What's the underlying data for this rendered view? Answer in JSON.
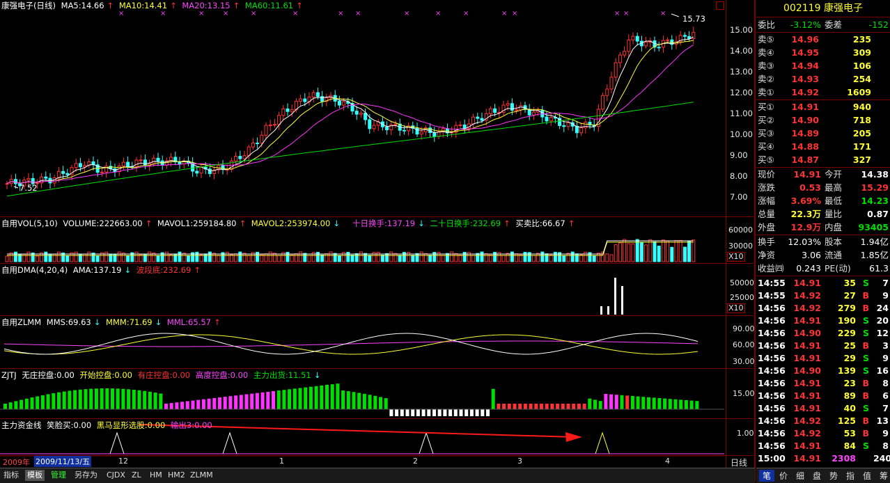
{
  "header": {
    "title": "康强电子(日线)",
    "ma5": "MA5:14.66",
    "ma10": "MA10:14.41",
    "ma20": "MA20:13.15",
    "ma60": "MA60:11.61",
    "high_label": "15.73",
    "low_label": "7.52"
  },
  "price_axis": [
    "15.00",
    "14.00",
    "13.00",
    "12.00",
    "11.00",
    "10.00",
    "9.00",
    "8.00",
    "7.00"
  ],
  "vol_panel": {
    "name": "自用VOL(5,10)",
    "volume": "VOLUME:222663.00",
    "mavol1": "MAVOL1:259184.80",
    "mavol2": "MAVOL2:253974.00",
    "turnover10": "十日换手:137.19",
    "turnover20": "二十日换手:232.69",
    "buysell": "买卖比:66.67",
    "axis": [
      "60000",
      "30000"
    ],
    "unit": "X10"
  },
  "dma_panel": {
    "name": "自用DMA(4,20,4)",
    "ama": "AMA:137.19",
    "wave": "波段底:232.69",
    "axis": [
      "50000",
      "25000"
    ],
    "unit": "X10"
  },
  "zlmm_panel": {
    "name": "自用ZLMM",
    "mms": "MMS:69.63",
    "mmm": "MMM:71.69",
    "mml": "MML:65.57",
    "axis": [
      "90.00",
      "60.00",
      "30.00"
    ]
  },
  "zjtj_panel": {
    "name": "ZJTJ",
    "a": "无庄控盘:0.00",
    "b": "开始控盘:0.00",
    "c": "有庄控盘:0.00",
    "d": "高度控盘:0.00",
    "e": "主力出货:11.51",
    "axis": [
      "15.00"
    ]
  },
  "zlzj_panel": {
    "name": "主力资金线",
    "a": "笑脸买:0.00",
    "b": "黑马显形选股:0.00",
    "c": "输出3:0.00",
    "axis": [
      "1.00"
    ]
  },
  "x_axis": {
    "year": "2009年",
    "date": "2009/11/13/五",
    "labels": [
      "12",
      "1",
      "2",
      "3",
      "4"
    ],
    "period": "日线"
  },
  "quote": {
    "code": "002119",
    "name": "康强电子",
    "weibi_label": "委比",
    "weibi": "-3.12%",
    "weicha_label": "委差",
    "weicha": "-152",
    "asks": [
      {
        "label": "卖⑤",
        "price": "14.96",
        "vol": "235"
      },
      {
        "label": "卖④",
        "price": "14.95",
        "vol": "309"
      },
      {
        "label": "卖③",
        "price": "14.94",
        "vol": "106"
      },
      {
        "label": "卖②",
        "price": "14.93",
        "vol": "254"
      },
      {
        "label": "卖①",
        "price": "14.92",
        "vol": "1609"
      }
    ],
    "bids": [
      {
        "label": "买①",
        "price": "14.91",
        "vol": "940"
      },
      {
        "label": "买②",
        "price": "14.90",
        "vol": "718"
      },
      {
        "label": "买③",
        "price": "14.89",
        "vol": "205"
      },
      {
        "label": "买④",
        "price": "14.88",
        "vol": "171"
      },
      {
        "label": "买⑤",
        "price": "14.87",
        "vol": "327"
      }
    ],
    "stats": [
      {
        "l1": "现价",
        "v1": "14.91",
        "c1": "red",
        "l2": "今开",
        "v2": "14.38",
        "c2": "wht"
      },
      {
        "l1": "涨跌",
        "v1": "0.53",
        "c1": "red",
        "l2": "最高",
        "v2": "15.29",
        "c2": "red"
      },
      {
        "l1": "涨幅",
        "v1": "3.69%",
        "c1": "red",
        "l2": "最低",
        "v2": "14.23",
        "c2": "grn"
      },
      {
        "l1": "总量",
        "v1": "22.3万",
        "c1": "yel",
        "l2": "量比",
        "v2": "0.87",
        "c2": "wht"
      },
      {
        "l1": "外盘",
        "v1": "12.9万",
        "c1": "red",
        "l2": "内盘",
        "v2": "93405",
        "c2": "grn"
      }
    ],
    "stats2": [
      {
        "l1": "换手",
        "v1": "12.03%",
        "l2": "股本",
        "v2": "1.94亿"
      },
      {
        "l1": "净资",
        "v1": "3.06",
        "l2": "流通",
        "v2": "1.85亿"
      },
      {
        "l1": "收益㈣",
        "v1": "0.243",
        "l2": "PE(动)",
        "v2": "61.3"
      }
    ],
    "ticks": [
      {
        "t": "14:55",
        "p": "14.91",
        "v": "35",
        "s": "S",
        "n": "7"
      },
      {
        "t": "14:55",
        "p": "14.92",
        "v": "27",
        "s": "B",
        "n": "9"
      },
      {
        "t": "14:56",
        "p": "14.92",
        "v": "279",
        "s": "B",
        "n": "24"
      },
      {
        "t": "14:56",
        "p": "14.91",
        "v": "190",
        "s": "S",
        "n": "20"
      },
      {
        "t": "14:56",
        "p": "14.90",
        "v": "229",
        "s": "S",
        "n": "12"
      },
      {
        "t": "14:56",
        "p": "14.91",
        "v": "25",
        "s": "B",
        "n": "3"
      },
      {
        "t": "14:56",
        "p": "14.91",
        "v": "29",
        "s": "S",
        "n": "9"
      },
      {
        "t": "14:56",
        "p": "14.90",
        "v": "139",
        "s": "S",
        "n": "16"
      },
      {
        "t": "14:56",
        "p": "14.91",
        "v": "23",
        "s": "B",
        "n": "8"
      },
      {
        "t": "14:56",
        "p": "14.91",
        "v": "89",
        "s": "B",
        "n": "6"
      },
      {
        "t": "14:56",
        "p": "14.91",
        "v": "40",
        "s": "S",
        "n": "7"
      },
      {
        "t": "14:56",
        "p": "14.92",
        "v": "125",
        "s": "B",
        "n": "13"
      },
      {
        "t": "14:56",
        "p": "14.92",
        "v": "53",
        "s": "B",
        "n": "9"
      },
      {
        "t": "14:56",
        "p": "14.91",
        "v": "84",
        "s": "S",
        "n": "8"
      },
      {
        "t": "15:00",
        "p": "14.91",
        "v": "2308",
        "s": "",
        "n": "240"
      }
    ]
  },
  "bottom_tabs": [
    "指标",
    "模板",
    "管理",
    "另存为",
    "CJDX",
    "ZL",
    "HM",
    "HM2",
    "ZLMM"
  ],
  "right_tabs": [
    "笔",
    "价",
    "细",
    "盘",
    "势",
    "指",
    "值",
    "筹"
  ],
  "colors": {
    "up": "#ff3333",
    "down": "#33ffff",
    "ma5": "#ffffff",
    "ma10": "#ffff33",
    "ma20": "#ff33ff",
    "ma60": "#00e000"
  }
}
